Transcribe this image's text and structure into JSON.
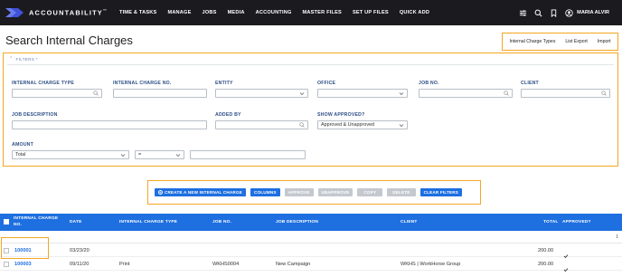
{
  "brand": {
    "name": "ACCOUNTABILITY",
    "tm": "™"
  },
  "nav": {
    "items": [
      "TIME & TASKS",
      "MANAGE",
      "JOBS",
      "MEDIA",
      "ACCOUNTING",
      "MASTER FILES",
      "SET UP FILES",
      "QUICK ADD"
    ],
    "user": "MARIA ALVIR"
  },
  "page": {
    "title": "Search Internal Charges"
  },
  "title_links": [
    "Internal Charge Types",
    "List Export",
    "Import"
  ],
  "filters": {
    "header": "FILTERS *",
    "labels": {
      "internal_charge_type": "INTERNAL CHARGE TYPE",
      "internal_charge_no": "INTERNAL CHARGE NO.",
      "entity": "ENTITY",
      "office": "OFFICE",
      "job_no": "JOB NO.",
      "client": "CLIENT",
      "job_description": "JOB DESCRIPTION",
      "added_by": "ADDED BY",
      "show_approved": "SHOW APPROVED?",
      "amount": "AMOUNT"
    },
    "values": {
      "show_approved": "Approved & Unapproved",
      "amount_type": "Total",
      "amount_op": "="
    }
  },
  "actions": {
    "create": "CREATE A NEW INTERNAL CHARGE",
    "columns": "COLUMNS",
    "approve": "APPROVE",
    "unapprove": "UNAPPROVE",
    "copy": "COPY",
    "delete": "DELETE",
    "clear": "CLEAR FILTERS"
  },
  "table": {
    "headers": {
      "charge_no_line1": "INTERNAL CHARGE",
      "charge_no_line2": "NO.",
      "date": "DATE",
      "type": "INTERNAL CHARGE TYPE",
      "job_no": "JOB NO.",
      "job_description": "JOB DESCRIPTION",
      "client": "CLIENT",
      "total": "TOTAL",
      "approved": "APPROVED?"
    },
    "group_count": "1",
    "rows": [
      {
        "charge_no": "100001",
        "date": "03/23/20",
        "type": "",
        "job_no": "",
        "job_description": "",
        "client": "",
        "total": "200.00",
        "approved": true
      },
      {
        "charge_no": "100003",
        "date": "09/11/20",
        "type": "Print",
        "job_no": "WKHS0004",
        "job_description": "New Campaign",
        "client": "WKHS | WorkHorse Group",
        "total": "200.00",
        "approved": true
      }
    ]
  },
  "colors": {
    "nav_bg": "#1b1b1f",
    "accent": "#1e6fe0",
    "highlight": "#f5a623",
    "label": "#2d4e85"
  }
}
